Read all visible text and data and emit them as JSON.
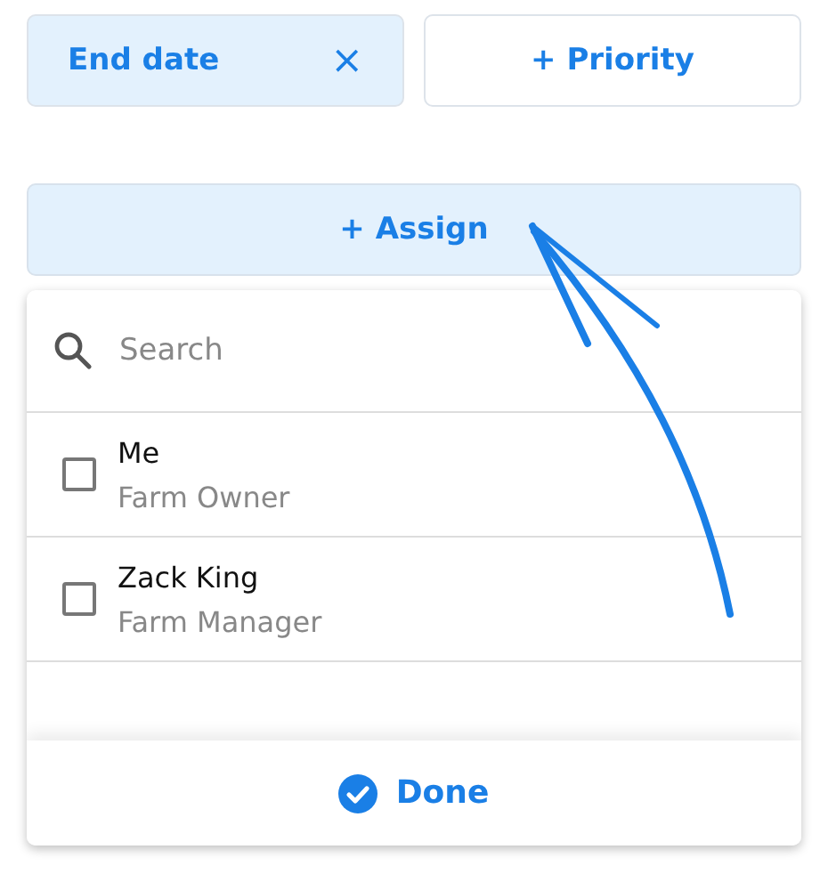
{
  "filters": [
    {
      "label": "End date",
      "selected": true,
      "close": "×"
    },
    {
      "label": "+ Priority",
      "selected": false
    }
  ],
  "assign_button": {
    "label": "+ Assign"
  },
  "dropdown": {
    "search": {
      "placeholder": "Search"
    },
    "people": [
      {
        "name": "Me",
        "role": "Farm Owner",
        "checked": false
      },
      {
        "name": "Zack King",
        "role": "Farm Manager",
        "checked": false
      }
    ],
    "done_button": {
      "label": "Done"
    }
  }
}
